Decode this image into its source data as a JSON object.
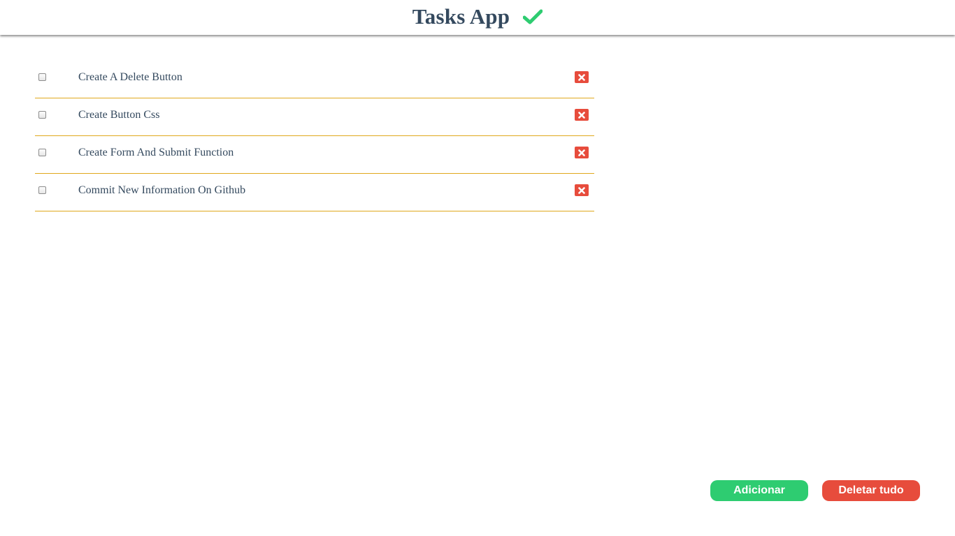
{
  "header": {
    "title": "Tasks App",
    "icon": "check-icon"
  },
  "tasks": [
    {
      "label": "Create A Delete Button",
      "checked": false
    },
    {
      "label": "Create Button Css",
      "checked": false
    },
    {
      "label": "Create Form And Submit Function",
      "checked": false
    },
    {
      "label": "Commit New Information On Github",
      "checked": false
    }
  ],
  "actions": {
    "add_label": "Adicionar",
    "delete_all_label": "Deletar tudo"
  },
  "colors": {
    "title": "#34495e",
    "check": "#2ecc71",
    "divider": "#e0a81c",
    "delete": "#e74c3c",
    "add": "#2ecc71"
  }
}
